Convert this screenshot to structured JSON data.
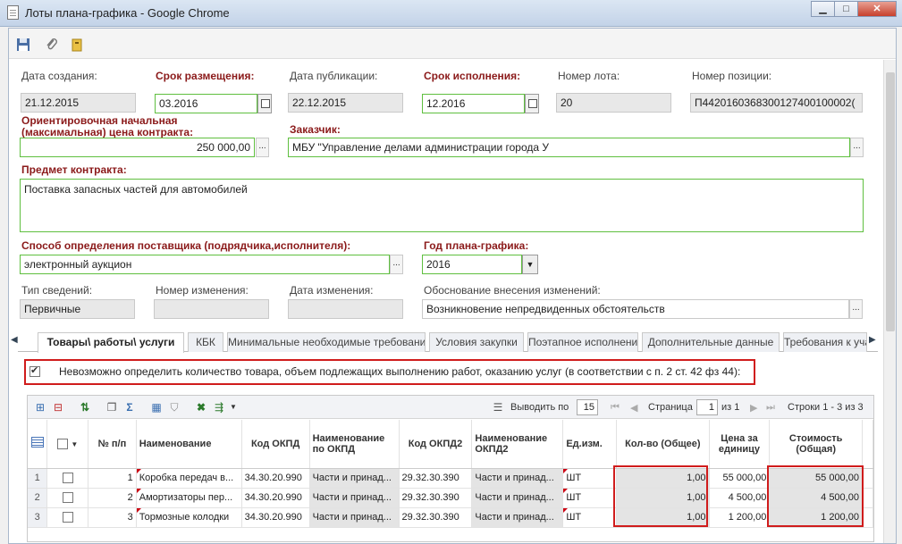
{
  "window": {
    "title": "Лоты плана-графика - Google Chrome"
  },
  "form": {
    "created_label": "Дата создания:",
    "created_value": "21.12.2015",
    "placement_label": "Срок размещения:",
    "placement_value": "03.2016",
    "publication_label": "Дата публикации:",
    "publication_value": "22.12.2015",
    "execution_label": "Срок исполнения:",
    "execution_value": "12.2016",
    "lot_no_label": "Номер лота:",
    "lot_no_value": "20",
    "position_label": "Номер позиции:",
    "position_value": "П4420160368300127400100002(",
    "price_label": "Ориентировочная начальная (максимальная) цена контракта:",
    "price_value": "250 000,00",
    "customer_label": "Заказчик:",
    "customer_value": "МБУ \"Управление делами администрации города У",
    "subject_label": "Предмет контракта:",
    "subject_value": "Поставка запасных частей для автомобилей",
    "method_label": "Способ определения поставщика (подрядчика,исполнителя):",
    "method_value": "электронный аукцион",
    "year_label": "Год плана-графика:",
    "year_value": "2016",
    "info_type_label": "Тип сведений:",
    "info_type_value": "Первичные",
    "change_no_label": "Номер изменения:",
    "change_no_value": "",
    "change_date_label": "Дата изменения:",
    "change_date_value": "",
    "reason_label": "Обоснование внесения изменений:",
    "reason_value": "Возникновение непредвиденных обстоятельств"
  },
  "tabs": [
    {
      "label": "Товары\\ работы\\ услуги"
    },
    {
      "label": "КБК"
    },
    {
      "label": "Минимальные необходимые требования"
    },
    {
      "label": "Условия закупки"
    },
    {
      "label": "Поэтапное исполнение"
    },
    {
      "label": "Дополнительные данные"
    },
    {
      "label": "Требования к уча"
    }
  ],
  "cannot_determine": {
    "checked": true,
    "text": "Невозможно определить количество товара, объем подлежащих выполнению работ, оказанию услуг (в соответствии с п. 2 ст. 42 фз 44):"
  },
  "pager": {
    "show_label": "Выводить по",
    "page_size": "15",
    "page_label": "Страница",
    "page": "1",
    "of_label": "из 1",
    "rows_label": "Строки 1 - 3 из 3"
  },
  "grid": {
    "headers": {
      "num": "№ п/п",
      "name": "Наименование",
      "okpd": "Код ОКПД",
      "okpd_name": "Наименование по ОКПД",
      "okpd2": "Код ОКПД2",
      "okpd2_name": "Наименование ОКПД2",
      "unit": "Ед.изм.",
      "qty": "Кол-во (Общее)",
      "price": "Цена за единицу",
      "cost": "Стоимость (Общая)"
    },
    "rows": [
      {
        "idx": "1",
        "num": "1",
        "name": "Коробка передач в...",
        "okpd": "34.30.20.990",
        "okpd_name": "Части и принад...",
        "okpd2": "29.32.30.390",
        "okpd2_name": "Части и принад...",
        "unit": "ШТ",
        "qty": "1,00",
        "price": "55 000,00",
        "cost": "55 000,00"
      },
      {
        "idx": "2",
        "num": "2",
        "name": "Амортизаторы пер...",
        "okpd": "34.30.20.990",
        "okpd_name": "Части и принад...",
        "okpd2": "29.32.30.390",
        "okpd2_name": "Части и принад...",
        "unit": "ШТ",
        "qty": "1,00",
        "price": "4 500,00",
        "cost": "4 500,00"
      },
      {
        "idx": "3",
        "num": "3",
        "name": "Тормозные колодки",
        "okpd": "34.30.20.990",
        "okpd_name": "Части и принад...",
        "okpd2": "29.32.30.390",
        "okpd2_name": "Части и принад...",
        "unit": "ШТ",
        "qty": "1,00",
        "price": "1 200,00",
        "cost": "1 200,00"
      }
    ]
  }
}
